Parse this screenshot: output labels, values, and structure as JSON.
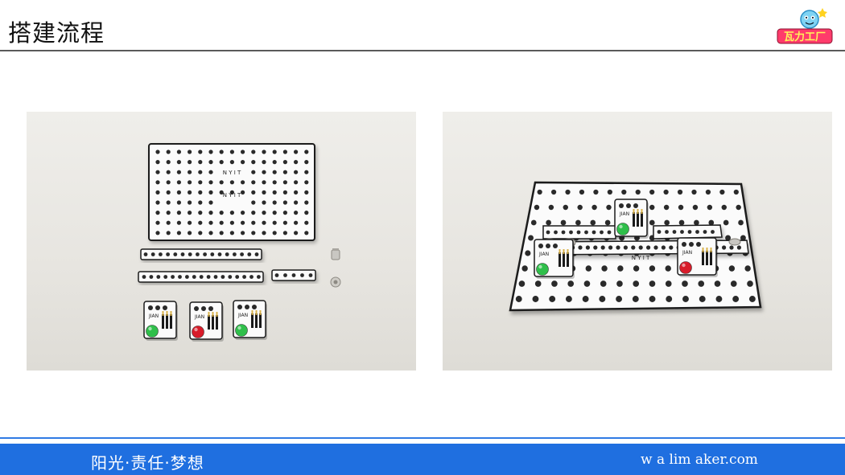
{
  "header": {
    "title": "搭建流程",
    "logo_text": "瓦力工厂"
  },
  "photos": [
    {
      "name": "parts-laid-out",
      "board_text": [
        "N Y I T",
        "N Y I T"
      ],
      "module_text": "JIAN"
    },
    {
      "name": "assembled-board",
      "board_text": [
        "N Y I T"
      ],
      "module_text": "JIAN"
    }
  ],
  "footer": {
    "slogan": "阳光·责任·梦想",
    "website": "w a lim aker.com"
  },
  "colors": {
    "accent": "#1f6fe0",
    "led_green": "#2fbf4a",
    "led_red": "#d81c2a"
  }
}
